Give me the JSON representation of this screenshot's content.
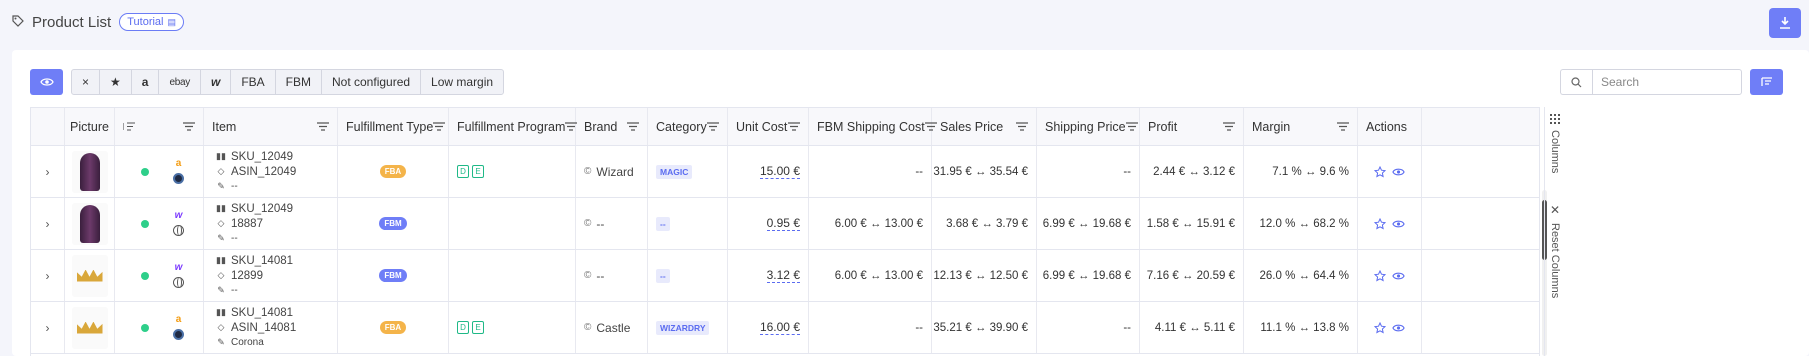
{
  "header": {
    "title": "Product List",
    "tutorial": "Tutorial"
  },
  "toolbar": {
    "filters": [
      "×",
      "★",
      "a",
      "ebay",
      "w",
      "FBA",
      "FBM",
      "Not configured",
      "Low margin"
    ],
    "search_placeholder": "Search"
  },
  "columns": [
    "Picture",
    "Item",
    "Fulfillment Type",
    "Fulfillment Program",
    "Brand",
    "Category",
    "Unit Cost",
    "FBM Shipping Cost",
    "Sales Price",
    "Shipping Price",
    "Profit",
    "Margin",
    "Actions"
  ],
  "rows": [
    {
      "sku": "SKU_12049",
      "id": "ASIN_12049",
      "note": "--",
      "type": "FBA",
      "programs": [
        "D",
        "E"
      ],
      "brand": "Wizard",
      "category": "MAGIC",
      "unit_cost": "15.00 €",
      "fbm_ship": "--",
      "sales": "31.95 €  ↔  35.54 €",
      "ship": "--",
      "profit": "2.44 €  ↔  3.12 €",
      "margin": "7.1 %  ↔  9.6 %",
      "marketplace": "amazon",
      "pic": "hoodie"
    },
    {
      "sku": "SKU_12049",
      "id": "18887",
      "note": "--",
      "type": "FBM",
      "programs": [],
      "brand": "--",
      "category": "--",
      "unit_cost": "0.95 €",
      "fbm_ship": "6.00 €  ↔  13.00 €",
      "sales": "3.68 €  ↔  3.79 €",
      "ship": "6.99 €  ↔  19.68 €",
      "profit": "1.58 €  ↔  15.91 €",
      "margin": "12.0 %  ↔  68.2 %",
      "marketplace": "wix",
      "pic": "hoodie"
    },
    {
      "sku": "SKU_14081",
      "id": "12899",
      "note": "--",
      "type": "FBM",
      "programs": [],
      "brand": "--",
      "category": "--",
      "unit_cost": "3.12 €",
      "fbm_ship": "6.00 €  ↔  13.00 €",
      "sales": "12.13 €  ↔  12.50 €",
      "ship": "6.99 €  ↔  19.68 €",
      "profit": "7.16 €  ↔  20.59 €",
      "margin": "26.0 %  ↔  64.4 %",
      "marketplace": "wix",
      "pic": "crown"
    },
    {
      "sku": "SKU_14081",
      "id": "ASIN_14081",
      "note": "Corona",
      "type": "FBA",
      "programs": [
        "D",
        "E"
      ],
      "brand": "Castle",
      "category": "WIZARDRY",
      "unit_cost": "16.00 €",
      "fbm_ship": "--",
      "sales": "35.21 €  ↔  39.90 €",
      "ship": "--",
      "profit": "4.11 €  ↔  5.11 €",
      "margin": "11.1 %  ↔  13.8 %",
      "marketplace": "amazon",
      "pic": "crown"
    }
  ],
  "side": {
    "columns": "Columns",
    "reset": "Reset Columns"
  },
  "colors": {
    "accent": "#6f7ef7",
    "ok": "#2ecf8a",
    "fba": "#f4b44a"
  }
}
